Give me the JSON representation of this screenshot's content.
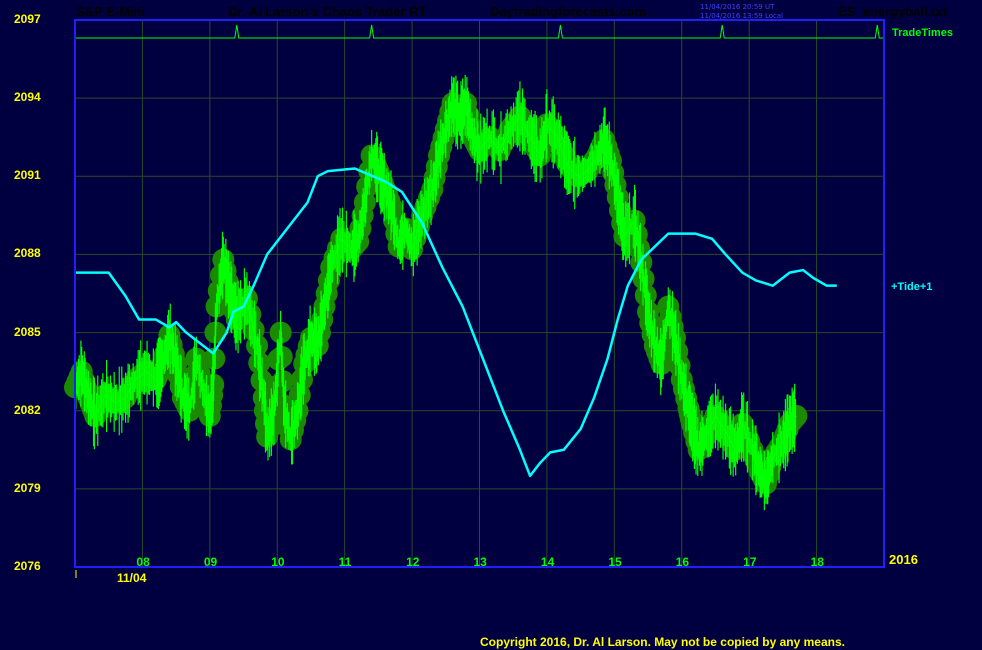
{
  "header": {
    "symbol": "S&P E-Mini",
    "app_title": "Dr. Al Larson's Chaos Trader RT",
    "website": "Daytradingforecasts.com",
    "timestamp_ut": "11/04/2016 20:59 UT",
    "timestamp_local": "11/04/2016 13:59 Local",
    "file_name": "ES_energyball.txt",
    "colors": {
      "symbol": "#ff2020",
      "app_title": "#ffff00",
      "website": "#ff00ff",
      "file_name": "#4040ff"
    }
  },
  "labels": {
    "trade_times": "TradeTimes",
    "tide": "+Tide+1",
    "date": "11/04",
    "year": "2016",
    "copyright": "Copyright 2016, Dr. Al Larson. May not be copied by any means."
  },
  "chart_data": {
    "type": "line",
    "title": "",
    "xlabel": "",
    "ylabel": "",
    "ylim": [
      2076,
      2097
    ],
    "yticks": [
      "2097",
      "2094",
      "2091",
      "2088",
      "2085",
      "2082",
      "2079",
      "2076"
    ],
    "xlim": [
      7,
      19
    ],
    "xticks": [
      "08",
      "09",
      "10",
      "11",
      "12",
      "13",
      "14",
      "15",
      "16",
      "17",
      "18"
    ],
    "grid": true,
    "colors": {
      "background": "#000040",
      "frame": "#2020ff",
      "grid": "#2a4a2a",
      "price": "#00ff00",
      "ball": "#1a8a00",
      "tide": "#00ffff",
      "trade_times": "#00ff00"
    },
    "trade_time_spikes": [
      9.4,
      11.4,
      14.2,
      16.6,
      18.9
    ],
    "series": [
      {
        "name": "",
        "points": [
          [
            7.0,
            2082.9
          ],
          [
            7.1,
            2083.5
          ],
          [
            7.2,
            2082.5
          ],
          [
            7.3,
            2081.8
          ],
          [
            7.45,
            2082.6
          ],
          [
            7.6,
            2082.3
          ],
          [
            7.75,
            2082.5
          ],
          [
            7.9,
            2083.2
          ],
          [
            8.05,
            2083.5
          ],
          [
            8.2,
            2083.2
          ],
          [
            8.3,
            2083.8
          ],
          [
            8.4,
            2084.9
          ],
          [
            8.5,
            2083.8
          ],
          [
            8.6,
            2082.5
          ],
          [
            8.7,
            2082.0
          ],
          [
            8.8,
            2084.0
          ],
          [
            8.95,
            2082.2
          ],
          [
            9.0,
            2081.8
          ],
          [
            9.05,
            2083.0
          ],
          [
            9.1,
            2086.0
          ],
          [
            9.2,
            2087.8
          ],
          [
            9.3,
            2086.5
          ],
          [
            9.4,
            2085.5
          ],
          [
            9.55,
            2086.3
          ],
          [
            9.7,
            2084.5
          ],
          [
            9.8,
            2082.5
          ],
          [
            9.85,
            2081.0
          ],
          [
            9.95,
            2081.9
          ],
          [
            10.05,
            2085.0
          ],
          [
            10.1,
            2082.2
          ],
          [
            10.2,
            2080.9
          ],
          [
            10.3,
            2082.0
          ],
          [
            10.4,
            2083.8
          ],
          [
            10.5,
            2084.8
          ],
          [
            10.6,
            2084.5
          ],
          [
            10.7,
            2086.0
          ],
          [
            10.8,
            2087.5
          ],
          [
            10.95,
            2088.6
          ],
          [
            11.1,
            2088.2
          ],
          [
            11.2,
            2088.5
          ],
          [
            11.3,
            2090.0
          ],
          [
            11.4,
            2091.8
          ],
          [
            11.5,
            2091.2
          ],
          [
            11.6,
            2090.5
          ],
          [
            11.7,
            2089.8
          ],
          [
            11.8,
            2088.3
          ],
          [
            11.9,
            2089.0
          ],
          [
            12.0,
            2088.2
          ],
          [
            12.15,
            2089.5
          ],
          [
            12.3,
            2090.5
          ],
          [
            12.4,
            2091.8
          ],
          [
            12.5,
            2092.8
          ],
          [
            12.6,
            2093.8
          ],
          [
            12.7,
            2093.2
          ],
          [
            12.8,
            2093.8
          ],
          [
            12.9,
            2092.5
          ],
          [
            13.0,
            2092.0
          ],
          [
            13.15,
            2092.5
          ],
          [
            13.3,
            2092.0
          ],
          [
            13.45,
            2092.8
          ],
          [
            13.6,
            2093.3
          ],
          [
            13.75,
            2092.5
          ],
          [
            13.9,
            2091.8
          ],
          [
            14.0,
            2093.0
          ],
          [
            14.15,
            2092.5
          ],
          [
            14.3,
            2091.5
          ],
          [
            14.45,
            2091.0
          ],
          [
            14.6,
            2091.2
          ],
          [
            14.75,
            2091.8
          ],
          [
            14.85,
            2092.4
          ],
          [
            14.95,
            2091.6
          ],
          [
            15.05,
            2090.2
          ],
          [
            15.15,
            2088.7
          ],
          [
            15.3,
            2089.3
          ],
          [
            15.4,
            2087.7
          ],
          [
            15.5,
            2085.8
          ],
          [
            15.6,
            2084.5
          ],
          [
            15.7,
            2083.8
          ],
          [
            15.8,
            2086.0
          ],
          [
            15.9,
            2084.8
          ],
          [
            16.0,
            2083.2
          ],
          [
            16.1,
            2082.1
          ],
          [
            16.15,
            2081.5
          ],
          [
            16.25,
            2080.5
          ],
          [
            16.35,
            2081.0
          ],
          [
            16.5,
            2081.8
          ],
          [
            16.65,
            2081.2
          ],
          [
            16.8,
            2080.5
          ],
          [
            16.9,
            2081.5
          ],
          [
            17.05,
            2080.5
          ],
          [
            17.15,
            2079.7
          ],
          [
            17.25,
            2079.2
          ],
          [
            17.35,
            2080.2
          ],
          [
            17.5,
            2080.8
          ],
          [
            17.6,
            2081.5
          ],
          [
            17.7,
            2081.8
          ]
        ]
      },
      {
        "name": "+Tide+1",
        "points": [
          [
            7.0,
            2087.3
          ],
          [
            7.5,
            2087.3
          ],
          [
            7.75,
            2086.4
          ],
          [
            7.95,
            2085.5
          ],
          [
            8.2,
            2085.5
          ],
          [
            8.4,
            2085.2
          ],
          [
            8.5,
            2085.4
          ],
          [
            8.65,
            2085.0
          ],
          [
            8.95,
            2084.4
          ],
          [
            9.05,
            2084.2
          ],
          [
            9.25,
            2085.0
          ],
          [
            9.35,
            2085.8
          ],
          [
            9.5,
            2086.0
          ],
          [
            9.65,
            2086.8
          ],
          [
            9.85,
            2088.0
          ],
          [
            10.15,
            2089.0
          ],
          [
            10.3,
            2089.5
          ],
          [
            10.45,
            2090.0
          ],
          [
            10.6,
            2091.0
          ],
          [
            10.75,
            2091.2
          ],
          [
            11.15,
            2091.3
          ],
          [
            11.6,
            2090.8
          ],
          [
            11.85,
            2090.4
          ],
          [
            12.15,
            2089.2
          ],
          [
            12.45,
            2087.5
          ],
          [
            12.75,
            2086.0
          ],
          [
            13.05,
            2084.0
          ],
          [
            13.35,
            2082.0
          ],
          [
            13.6,
            2080.5
          ],
          [
            13.75,
            2079.5
          ],
          [
            13.9,
            2080.0
          ],
          [
            14.05,
            2080.4
          ],
          [
            14.25,
            2080.5
          ],
          [
            14.5,
            2081.3
          ],
          [
            14.7,
            2082.5
          ],
          [
            14.9,
            2084.0
          ],
          [
            15.05,
            2085.5
          ],
          [
            15.2,
            2086.8
          ],
          [
            15.4,
            2087.8
          ],
          [
            15.6,
            2088.3
          ],
          [
            15.8,
            2088.8
          ],
          [
            16.2,
            2088.8
          ],
          [
            16.45,
            2088.6
          ],
          [
            16.65,
            2088.0
          ],
          [
            16.9,
            2087.3
          ],
          [
            17.1,
            2087.0
          ],
          [
            17.35,
            2086.8
          ],
          [
            17.6,
            2087.3
          ],
          [
            17.8,
            2087.4
          ],
          [
            17.95,
            2087.1
          ],
          [
            18.15,
            2086.8
          ],
          [
            18.3,
            2086.8
          ]
        ]
      }
    ]
  }
}
